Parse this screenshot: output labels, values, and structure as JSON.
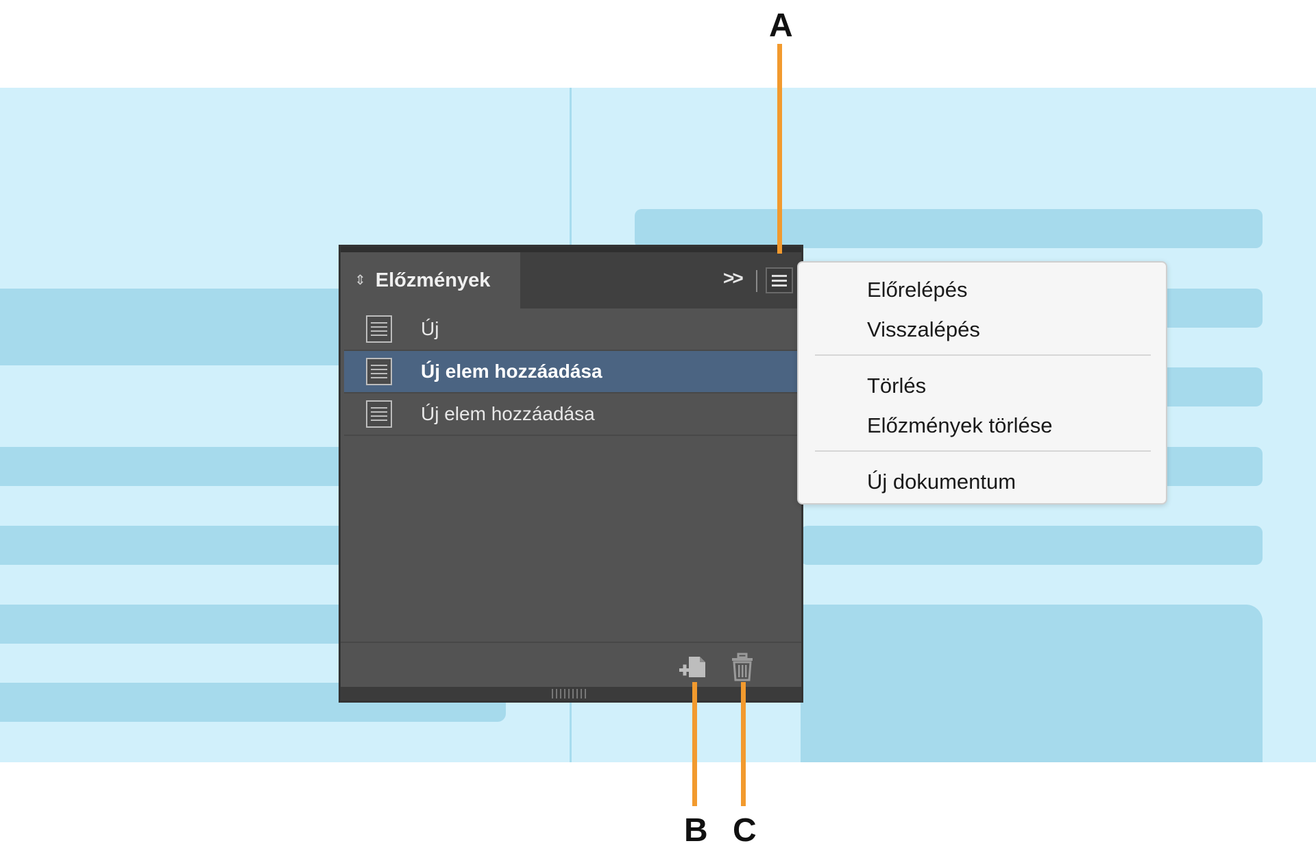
{
  "panel": {
    "tab_title": "Előzmények",
    "history_items": [
      {
        "label": "Új",
        "selected": false
      },
      {
        "label": "Új elem hozzáadása",
        "selected": true
      },
      {
        "label": "Új elem hozzáadása",
        "selected": false
      }
    ],
    "icons": {
      "tab_collapse": "⇕",
      "overflow": ">>"
    }
  },
  "menu": {
    "items": [
      "Előrelépés",
      "Visszalépés",
      "Törlés",
      "Előzmények törlése",
      "Új dokumentum"
    ]
  },
  "callouts": {
    "a": "A",
    "b": "B",
    "c": "C"
  },
  "colors": {
    "callout_line": "#f29a2e",
    "selection": "#4b6482",
    "panel_bg": "#535353",
    "canvas_bg": "#d1f0fb",
    "canvas_bar": "#a6daec"
  }
}
